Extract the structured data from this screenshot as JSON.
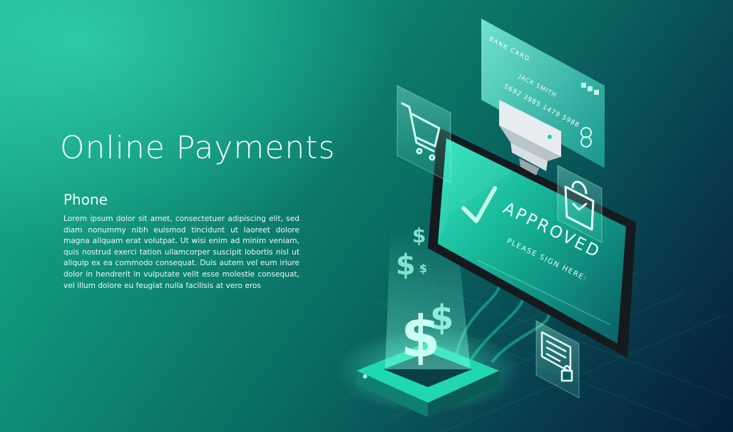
{
  "hero": {
    "title": "Online Payments",
    "subtitle": "Phone",
    "body": "Lorem ipsum dolor sit amet, consectetuer adipiscing elit, sed diam nonummy nibh euismod tincidunt ut laoreet dolore magna aliquam erat volutpat. Ut wisi enim ad minim veniam, quis nostrud exerci tation ullamcorper suscipit lobortis nisl ut aliquip ex ea commodo consequat. Duis autem vel eum iriure dolor in hendrerit in vulputate velit esse molestie consequat, vel illum dolore eu feugiat nulla facilisis at vero eros"
  },
  "card": {
    "label": "BANK CARD",
    "holder": "JACK SMITH",
    "number": "5692 3985 1479 5988"
  },
  "phone": {
    "status": "APPROVED",
    "instruction": "PLEASE SIGN HERE:"
  },
  "icons": {
    "cart": "shopping-cart-icon",
    "bag": "shopping-bag-icon",
    "document": "secure-document-icon",
    "check": "checkmark-icon",
    "dollar": "dollar-sign-icon"
  },
  "colors": {
    "accent": "#3ff0c8",
    "phone_body": "#141a1e",
    "background_dark": "#061f3a",
    "background_light": "#1bb38e"
  }
}
